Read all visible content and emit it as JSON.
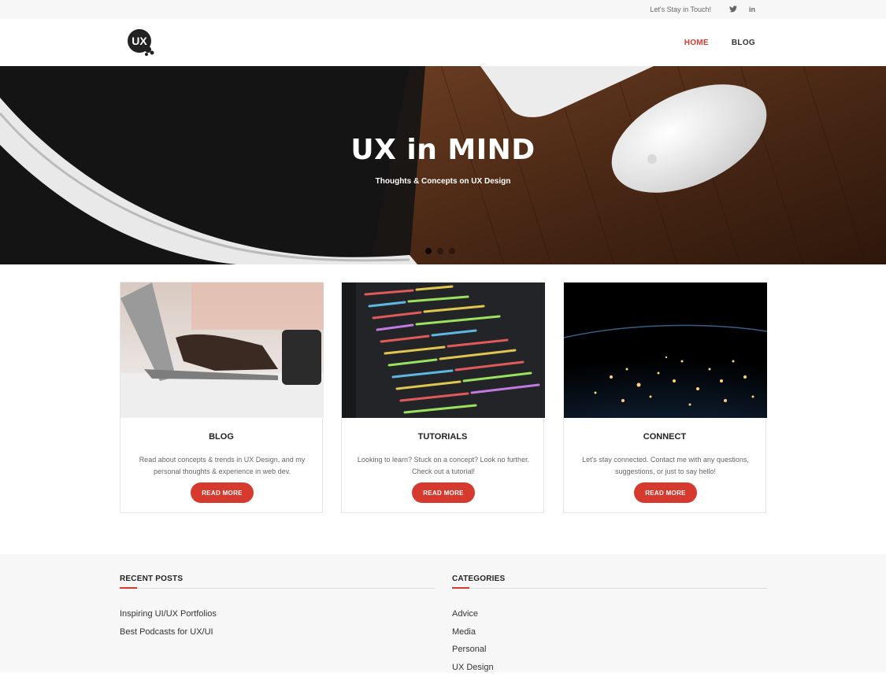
{
  "topbar": {
    "text": "Let's Stay in Touch!",
    "icons": [
      "twitter-icon",
      "linkedin-icon"
    ],
    "twitter_glyph": "𝕥",
    "linkedin_glyph": "in"
  },
  "header": {
    "logo_text": "UX",
    "nav": [
      {
        "label": "HOME",
        "active": true
      },
      {
        "label": "BLOG",
        "active": false
      }
    ]
  },
  "hero": {
    "title": "UX in MIND",
    "subtitle": "Thoughts & Concepts on UX Design",
    "slides": 3,
    "active_slide": 1
  },
  "cards": [
    {
      "title": "BLOG",
      "text": "Read about concepts & trends in UX Design, and my personal thoughts & experience in web dev.",
      "button": "READ MORE"
    },
    {
      "title": "TUTORIALS",
      "text": "Looking to learn? Stuck on a concept? Look no further. Check out a tutorial!",
      "button": "READ MORE"
    },
    {
      "title": "CONNECT",
      "text": "Let's stay connected. Contact me with any questions, suggestions, or just to say hello!",
      "button": "READ MORE"
    }
  ],
  "footer": {
    "recent_posts": {
      "title": "RECENT POSTS",
      "items": [
        "Inspiring UI/UX Portfolios",
        "Best Podcasts for UX/UI"
      ]
    },
    "categories": {
      "title": "CATEGORIES",
      "items": [
        "Advice",
        "Media",
        "Personal",
        "UX Design"
      ]
    }
  },
  "colors": {
    "accent": "#d63a2f",
    "topbar_bg": "#f7f7f7",
    "footer_bg": "#f7f7f7"
  }
}
